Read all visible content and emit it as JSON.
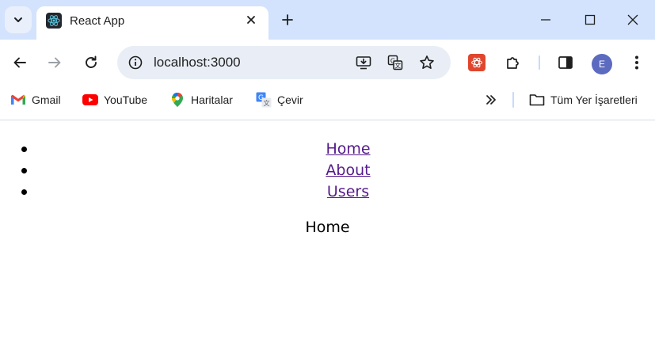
{
  "tabs": [
    {
      "title": "React App"
    }
  ],
  "address_bar": {
    "url": "localhost:3000"
  },
  "profile": {
    "initial": "E"
  },
  "bookmarks": [
    {
      "label": "Gmail",
      "icon": "gmail-icon"
    },
    {
      "label": "YouTube",
      "icon": "youtube-icon"
    },
    {
      "label": "Haritalar",
      "icon": "maps-icon"
    },
    {
      "label": "Çevir",
      "icon": "translate-icon"
    }
  ],
  "all_bookmarks": {
    "label": "Tüm Yer İşaretleri",
    "icon": "folder-icon"
  },
  "page": {
    "nav": [
      {
        "label": "Home"
      },
      {
        "label": "About"
      },
      {
        "label": "Users"
      }
    ],
    "heading": "Home"
  },
  "colors": {
    "tabstrip": "#d3e3fd",
    "omnibox": "#e9eef6",
    "visited_link": "#551a8b"
  }
}
